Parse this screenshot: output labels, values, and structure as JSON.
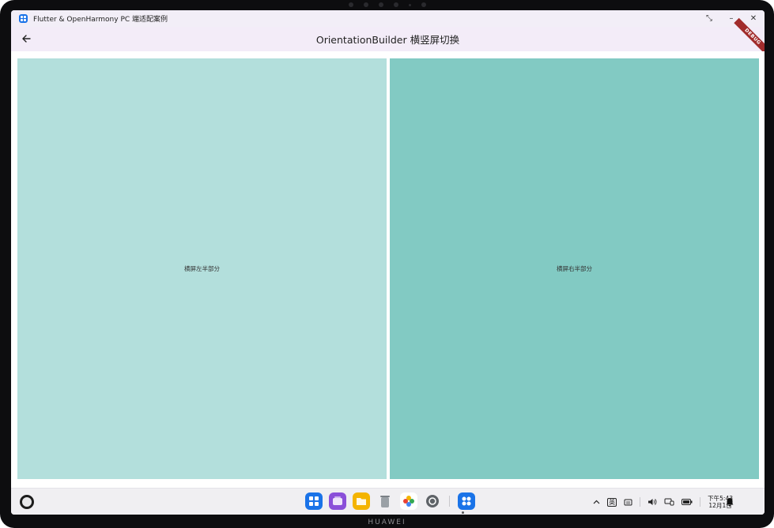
{
  "window": {
    "title": "Flutter & OpenHarmony PC 端适配案例",
    "controls": [
      "⤡",
      "–",
      "✕"
    ]
  },
  "appbar": {
    "title": "OrientationBuilder 横竖屏切换",
    "back_icon": "arrow-left-icon",
    "debug_label": "DEBUG"
  },
  "panels": {
    "left": {
      "label": "横屏左半部分",
      "color": "#b3dfdc"
    },
    "right": {
      "label": "横屏右半部分",
      "color": "#82cac3"
    }
  },
  "taskbar": {
    "dock": [
      {
        "name": "app-grid-icon",
        "color": "#1a73e8"
      },
      {
        "name": "multi-window-icon",
        "color": "#8a4fd9"
      },
      {
        "name": "files-icon",
        "color": "#f4b400"
      },
      {
        "name": "trash-icon",
        "color": "#9aa0a6"
      },
      {
        "name": "gallery-icon",
        "color": "#ffffff"
      },
      {
        "name": "settings-icon",
        "color": "#5f6368"
      },
      {
        "name": "flutter-app-icon",
        "color": "#1a73e8"
      }
    ],
    "tray": {
      "ime": "英",
      "clock_time": "下午5:43",
      "clock_date": "12月1日"
    }
  },
  "device": {
    "brand": "HUAWEI"
  }
}
